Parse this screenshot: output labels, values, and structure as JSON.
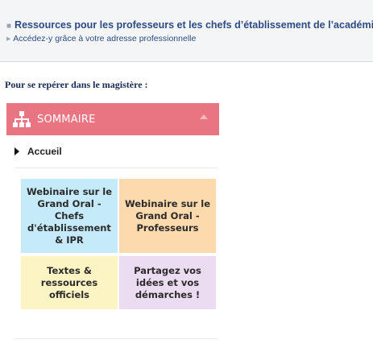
{
  "top": {
    "resources_link": "Ressources pour les professeurs et les chefs d’établissement de l’académie",
    "resources_bullet": "■",
    "access_link": "Accédez-y grâce à votre adresse professionnelle",
    "access_arrow": "▸"
  },
  "heading": "Pour se repérer dans le magistère :",
  "sommaire": {
    "title": "SOMMAIRE",
    "icon": "sitemap-icon",
    "background": "#e87581"
  },
  "nav": {
    "accueil": "Accueil"
  },
  "tiles": [
    {
      "label": "Webinaire sur le Grand Oral - Chefs d'établissement & IPR",
      "color": "#c5ebfa"
    },
    {
      "label": "Webinaire sur le Grand Oral - Professeurs",
      "color": "#fdd9ae"
    },
    {
      "label": "Textes & ressources officiels",
      "color": "#fdf4c4"
    },
    {
      "label": "Partagez vos idées et vos démarches !",
      "color": "#ecdcf1"
    }
  ]
}
